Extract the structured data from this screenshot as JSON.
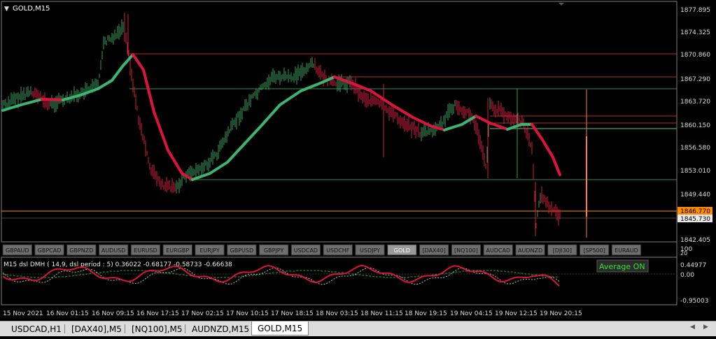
{
  "chart_title": "GOLD,M15",
  "indicator_title": "M15 dsl DMH ( 14,9, dsl period : 5)  0.36022  -0.68177  -0.58733  -0.66638",
  "average_badge": "Average ON",
  "colors": {
    "background": "#000000",
    "bull": "#3a9a5c",
    "bear": "#d0203f",
    "ma_up": "#3cb371",
    "ma_down": "#dc143c",
    "hline_red": "#b4283c",
    "hline_green": "#3a8a4e",
    "orange": "#ff8c00",
    "axis_text": "#dddddd",
    "button_bg": "#6e6e6e",
    "button_active": "#9a9a9a"
  },
  "price_axis_labels": [
    "1877.895",
    "1874.325",
    "1870.860",
    "1867.290",
    "1863.720",
    "1860.150",
    "1856.580",
    "1853.010",
    "1849.440",
    "1842.405"
  ],
  "price_tags": {
    "orange": "1846.770",
    "bid": "1845.730"
  },
  "indicator_axis_labels": [
    "100",
    "20",
    "0.44977",
    "0.00",
    "-0.95003"
  ],
  "time_labels": [
    "15 Nov 2021",
    "16 Nov 01:15",
    "16 Nov 09:15",
    "16 Nov 17:15",
    "17 Nov 02:15",
    "17 Nov 10:15",
    "17 Nov 18:15",
    "18 Nov 03:15",
    "18 Nov 11:15",
    "18 Nov 19:15",
    "19 Nov 04:15",
    "19 Nov 12:15",
    "19 Nov 20:15"
  ],
  "symbol_buttons": [
    "GBPAUD",
    "GBPCAD",
    "GBPNZD",
    "AUDUSD",
    "EURUSD",
    "EURGBP",
    "EURJPY",
    "GBPUSD",
    "GBPJPY",
    "USDCAD",
    "USDCHF",
    "USDJPY",
    "GOLD",
    "[DAX40]",
    "[NQ100]",
    "AUDCAD",
    "AUDNZD",
    "[DJI30]",
    "[SP500]",
    "EURAUD"
  ],
  "active_symbol": "GOLD",
  "bottom_tabs": [
    "USDCAD,H1",
    "[DAX40],M5",
    "[NQ100],M5",
    "AUDNZD,M15",
    "GOLD,M15"
  ],
  "active_tab": "GOLD,M15",
  "chart_data": {
    "type": "line",
    "title": "GOLD,M15",
    "ylim": [
      1842.405,
      1877.895
    ],
    "x": [
      "15 Nov 2021",
      "16 Nov 01:15",
      "16 Nov 09:15",
      "16 Nov 17:15",
      "17 Nov 02:15",
      "17 Nov 10:15",
      "17 Nov 18:15",
      "18 Nov 03:15",
      "18 Nov 11:15",
      "18 Nov 19:15",
      "19 Nov 04:15",
      "19 Nov 12:15",
      "19 Nov 20:15"
    ],
    "series": [
      {
        "name": "",
        "values": [
          1862.8,
          1863.8,
          1866.0,
          1866.0,
          1851.5,
          1856.5,
          1865.5,
          1867.0,
          1862.5,
          1859.5,
          1862.0,
          1859.2,
          1852.0
        ]
      }
    ],
    "horizontal_levels": [
      1870.86,
      1867.29,
      1865.7,
      1862.2,
      1861.2,
      1860.0,
      1851.3,
      1846.77,
      1845.73
    ]
  }
}
